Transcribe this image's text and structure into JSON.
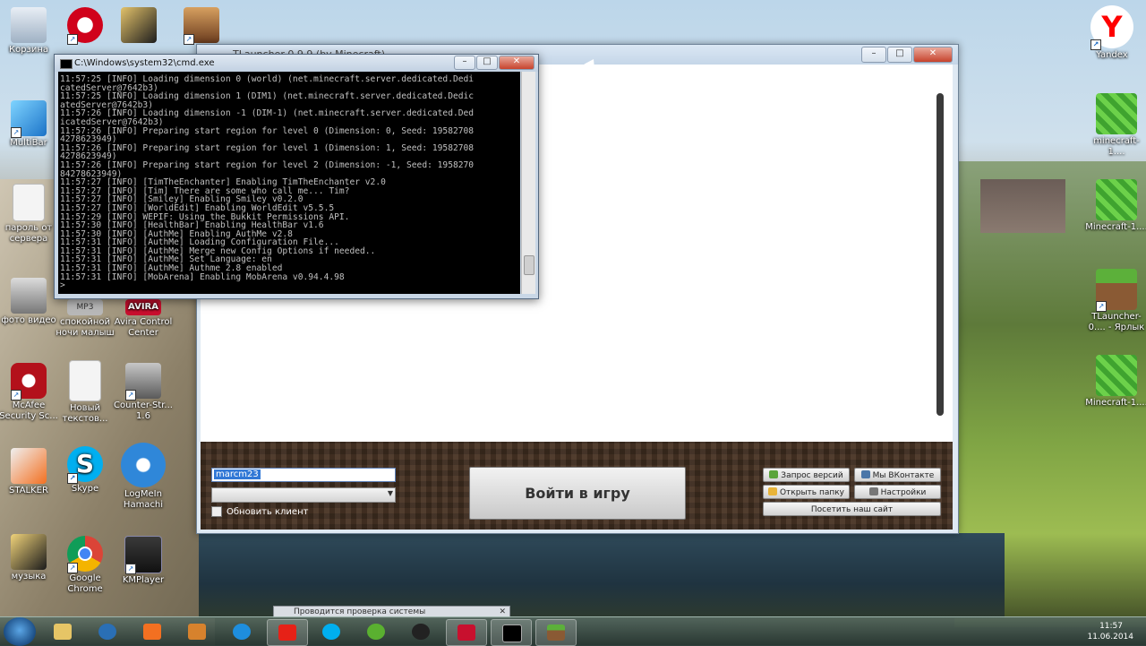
{
  "desktop_icons": [
    {
      "id": "recycle",
      "label": "Корзина",
      "icon": "recycle-bin-icon"
    },
    {
      "id": "multibar",
      "label": "MultiBar",
      "icon": "multibar-icon"
    },
    {
      "id": "passwords",
      "label": "пароль от сервера",
      "icon": "text-file-icon"
    },
    {
      "id": "photo",
      "label": "фото видео",
      "icon": "camera-icon"
    },
    {
      "id": "mp3",
      "label": "спокойной ночи малыш",
      "icon": "mp3-icon"
    },
    {
      "id": "avira",
      "label": "Avira Control Center",
      "icon": "avira-icon"
    },
    {
      "id": "mcafee",
      "label": "McAfee Security Sc...",
      "icon": "mcafee-icon"
    },
    {
      "id": "newtext",
      "label": "Новый текстов...",
      "icon": "text-file-icon"
    },
    {
      "id": "counter",
      "label": "Counter-Str... 1.6",
      "icon": "counter-strike-icon"
    },
    {
      "id": "stalker",
      "label": "STALKER",
      "icon": "media-player-icon"
    },
    {
      "id": "skype",
      "label": "Skype",
      "icon": "skype-icon"
    },
    {
      "id": "hamachi",
      "label": "LogMeIn Hamachi",
      "icon": "hamachi-icon"
    },
    {
      "id": "music",
      "label": "музыка",
      "icon": "folder-icon"
    },
    {
      "id": "chrome",
      "label": "Google Chrome",
      "icon": "chrome-icon"
    },
    {
      "id": "kmplayer",
      "label": "KMPlayer",
      "icon": "kmplayer-icon"
    },
    {
      "id": "yandex",
      "label": "Yandex",
      "icon": "yandex-icon"
    },
    {
      "id": "mc1",
      "label": "minecraft-1....",
      "icon": "minecraft-icon"
    },
    {
      "id": "mc2",
      "label": "Minecraft-1....",
      "icon": "minecraft-icon"
    },
    {
      "id": "tlauncher",
      "label": "TLauncher-0.... - Ярлык",
      "icon": "minecraft-grass-icon"
    },
    {
      "id": "mc3",
      "label": "Minecraft-1....",
      "icon": "minecraft-icon"
    }
  ],
  "cmd": {
    "title": "C:\\Windows\\system32\\cmd.exe",
    "lines": [
      "11:57:25 [INFO] Loading dimension 0 (world) (net.minecraft.server.dedicated.Dedi",
      "catedServer@7642b3)",
      "11:57:25 [INFO] Loading dimension 1 (DIM1) (net.minecraft.server.dedicated.Dedic",
      "atedServer@7642b3)",
      "11:57:26 [INFO] Loading dimension -1 (DIM-1) (net.minecraft.server.dedicated.Ded",
      "icatedServer@7642b3)",
      "11:57:26 [INFO] Preparing start region for level 0 (Dimension: 0, Seed: 19582708",
      "4278623949)",
      "11:57:26 [INFO] Preparing start region for level 1 (Dimension: 1, Seed: 19582708",
      "4278623949)",
      "11:57:26 [INFO] Preparing start region for level 2 (Dimension: -1, Seed: 1958270",
      "84278623949)",
      "11:57:27 [INFO] [TimTheEnchanter] Enabling TimTheEnchanter v2.0",
      "11:57:27 [INFO] [Tim] There are some who call me... Tim?",
      "11:57:27 [INFO] [Smiley] Enabling Smiley v0.2.0",
      "11:57:27 [INFO] [WorldEdit] Enabling WorldEdit v5.5.5",
      "11:57:29 [INFO] WEPIF: Using the Bukkit Permissions API.",
      "11:57:30 [INFO] [HealthBar] Enabling HealthBar v1.6",
      "11:57:30 [INFO] [AuthMe] Enabling AuthMe v2.8",
      "11:57:31 [INFO] [AuthMe] Loading Configuration File...",
      "11:57:31 [INFO] [AuthMe] Merge new Config Options if needed..",
      "11:57:31 [INFO] [AuthMe] Set Language: en",
      "11:57:31 [INFO] [AuthMe] Authme 2.8 enabled",
      "11:57:31 [INFO] [MobArena] Enabling MobArena v0.94.4.98",
      ">"
    ]
  },
  "launcher": {
    "title": "TLauncher 0.9.9 (by Minecraft)",
    "username": "marcm23",
    "version_select": "",
    "update_client_label": "Обновить клиент",
    "play_button": "Войти в игру",
    "request_versions": "Запрос версий",
    "vk_button": "Мы ВКонтакте",
    "open_folder": "Открыть папку",
    "settings": "Настройки",
    "visit_site": "Посетить наш сайт"
  },
  "taskbar": {
    "notification": "Проводится проверка системы",
    "time": "11:57",
    "date": "11.06.2014"
  }
}
